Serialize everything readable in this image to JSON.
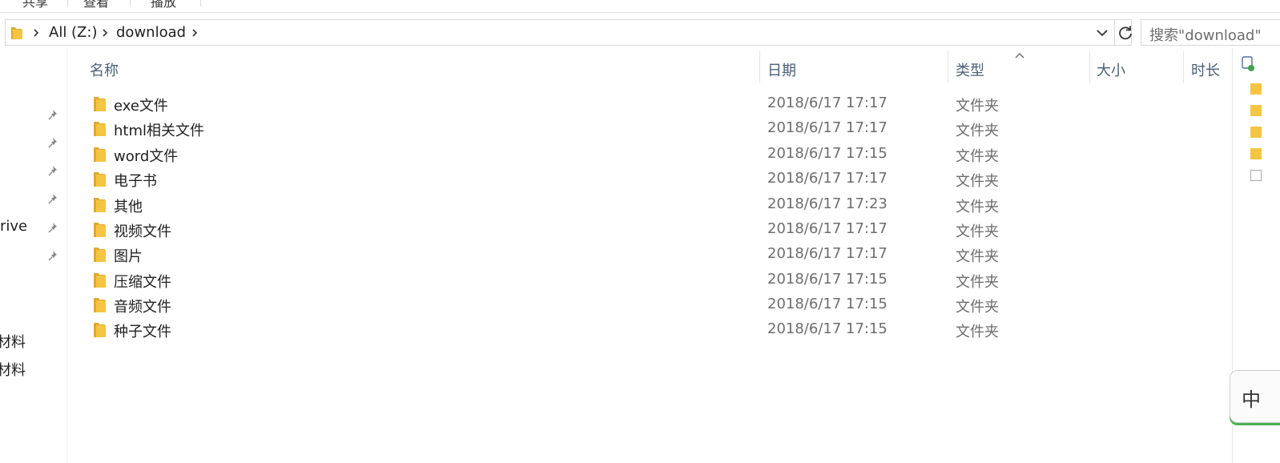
{
  "ribbon": {
    "tabs": [
      "共享",
      "查看",
      "播放"
    ]
  },
  "address_bar": {
    "crumbs": [
      "All (Z:)",
      "download"
    ]
  },
  "search": {
    "placeholder": "搜索\"download\""
  },
  "nav_pane": {
    "items": [
      "rive",
      "材料",
      "材料"
    ]
  },
  "columns": {
    "name": "名称",
    "date": "日期",
    "type": "类型",
    "size": "大小",
    "duration": "时长"
  },
  "files": [
    {
      "name": "exe文件",
      "date": "2018/6/17 17:17",
      "type": "文件夹"
    },
    {
      "name": "html相关文件",
      "date": "2018/6/17 17:17",
      "type": "文件夹"
    },
    {
      "name": "word文件",
      "date": "2018/6/17 17:15",
      "type": "文件夹"
    },
    {
      "name": "电子书",
      "date": "2018/6/17 17:17",
      "type": "文件夹"
    },
    {
      "name": "其他",
      "date": "2018/6/17 17:23",
      "type": "文件夹"
    },
    {
      "name": "视频文件",
      "date": "2018/6/17 17:17",
      "type": "文件夹"
    },
    {
      "name": "图片",
      "date": "2018/6/17 17:17",
      "type": "文件夹"
    },
    {
      "name": "压缩文件",
      "date": "2018/6/17 17:15",
      "type": "文件夹"
    },
    {
      "name": "音频文件",
      "date": "2018/6/17 17:15",
      "type": "文件夹"
    },
    {
      "name": "种子文件",
      "date": "2018/6/17 17:15",
      "type": "文件夹"
    }
  ],
  "floating_widget": {
    "label": "中"
  },
  "icons": {
    "folder": "folder-icon",
    "pin": "pin-icon",
    "chevron": "chevron-right-icon",
    "dropdown": "chevron-down-icon",
    "refresh": "refresh-icon",
    "sort": "sort-ascending-icon"
  },
  "colors": {
    "folder_yellow": "#f4c542",
    "folder_dark": "#e0a82e",
    "header_text": "#4c607a",
    "secondary_text": "#6d6d6d"
  }
}
